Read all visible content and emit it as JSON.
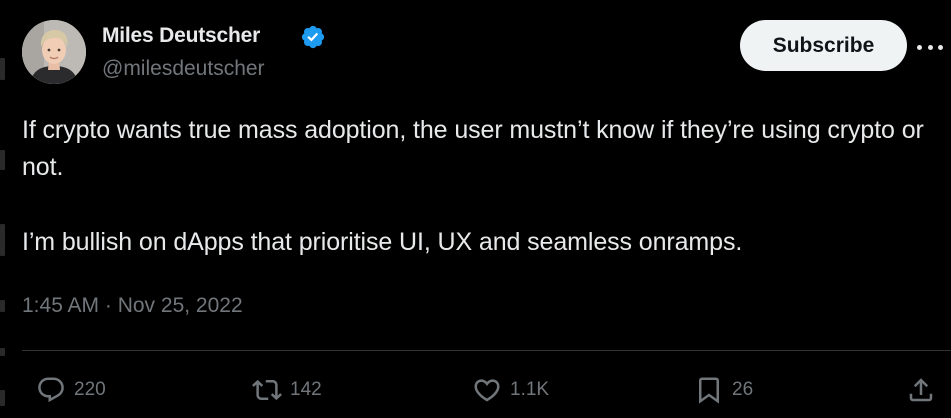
{
  "author": {
    "display_name": "Miles Deutscher",
    "handle": "@milesdeutscher",
    "verified": true
  },
  "subscribe_label": "Subscribe",
  "tweet": {
    "paragraphs": [
      "If crypto wants true mass adoption, the user mustn’t know if they’re using crypto or not.",
      "I’m bullish on dApps that prioritise UI, UX and seamless onramps."
    ],
    "timestamp": "1:45 AM · Nov 25, 2022"
  },
  "actions": {
    "replies": "220",
    "reposts": "142",
    "likes": "1.1K",
    "bookmarks": "26"
  },
  "icons": {
    "verified": "verified-badge-icon",
    "more": "more-options-icon",
    "reply": "reply-icon",
    "repost": "repost-icon",
    "like": "heart-icon",
    "bookmark": "bookmark-icon",
    "share": "share-icon"
  },
  "colors": {
    "background": "#000000",
    "primary_text": "#e7e9ea",
    "secondary_text": "#71767b",
    "verified_blue": "#1d9bf0",
    "button_bg": "#eff3f4",
    "divider": "#2f3336"
  }
}
